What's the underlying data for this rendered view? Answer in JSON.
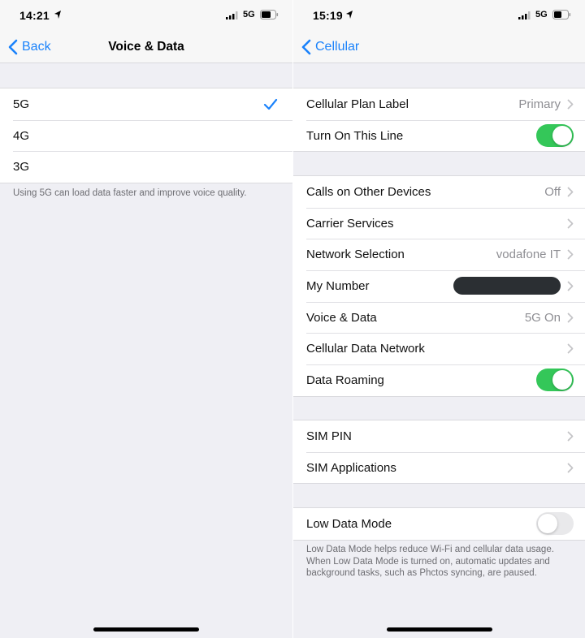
{
  "left_screen": {
    "status_bar": {
      "time": "14:21",
      "network": "5G"
    },
    "nav": {
      "back_label": "Back",
      "title": "Voice & Data"
    },
    "options": [
      {
        "label": "5G",
        "selected": true
      },
      {
        "label": "4G",
        "selected": false
      },
      {
        "label": "3G",
        "selected": false
      }
    ],
    "footer": "Using 5G can load data faster and improve voice quality."
  },
  "right_screen": {
    "status_bar": {
      "time": "15:19",
      "network": "5G"
    },
    "nav": {
      "back_label": "Cellular",
      "title": ""
    },
    "group1": [
      {
        "label": "Cellular Plan Label",
        "value": "Primary"
      },
      {
        "label": "Turn On This Line",
        "toggle": "on"
      }
    ],
    "group2": [
      {
        "label": "Calls on Other Devices",
        "value": "Off"
      },
      {
        "label": "Carrier Services",
        "value": ""
      },
      {
        "label": "Network Selection",
        "value": "vodafone IT"
      },
      {
        "label": "My Number",
        "value": "",
        "redacted": true
      },
      {
        "label": "Voice & Data",
        "value": "5G On"
      },
      {
        "label": "Cellular Data Network",
        "value": ""
      },
      {
        "label": "Data Roaming",
        "toggle": "on"
      }
    ],
    "group3": [
      {
        "label": "SIM PIN"
      },
      {
        "label": "SIM Applications"
      }
    ],
    "group4": [
      {
        "label": "Low Data Mode",
        "toggle": "off"
      }
    ],
    "footer": "Low Data Mode helps reduce Wi-Fi and cellular data usage. When Low Data Mode is turned on, automatic updates and background tasks, such as Phctos syncing, are paused."
  },
  "colors": {
    "accent": "#1a82fb",
    "toggle_on": "#34c759",
    "background": "#efeff4"
  },
  "icons": [
    "location-arrow-icon",
    "cellular-signal-icon",
    "battery-icon",
    "back-chevron-icon",
    "checkmark-icon",
    "chevron-right-icon"
  ]
}
